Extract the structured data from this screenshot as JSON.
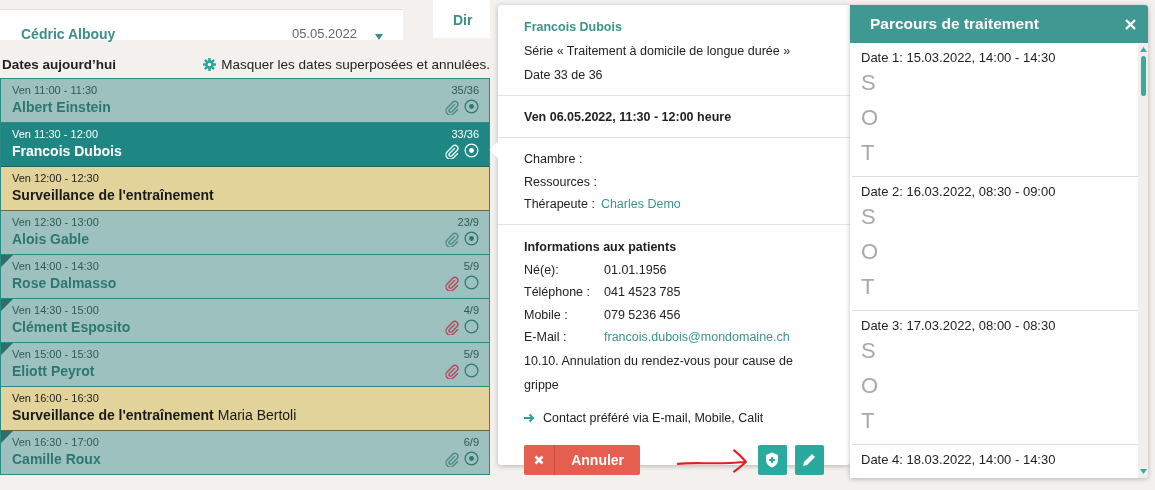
{
  "background_card": {
    "name": "Cédric Albouy",
    "date": "05.05.2022"
  },
  "side_card": {
    "label": "Dir"
  },
  "today": {
    "title": "Dates aujourd’hui",
    "toggle_label": "Masquer les dates superposées et annulées.",
    "appointments": [
      {
        "kind": "patient",
        "time": "Ven 11:00 - 11:30",
        "title": "Albert Einstein",
        "count": "35/36",
        "selected": false,
        "flagged": false,
        "completed": true,
        "attachment_warning": false
      },
      {
        "kind": "patient",
        "time": "Ven 11:30 - 12:00",
        "title": "Francois Dubois",
        "count": "33/36",
        "selected": true,
        "flagged": false,
        "completed": true,
        "attachment_warning": false
      },
      {
        "kind": "training",
        "time": "Ven 12:00 - 12:30",
        "title": "Surveillance de l'entraînement",
        "selected": false
      },
      {
        "kind": "patient",
        "time": "Ven 12:30 - 13:00",
        "title": "Alois Gable",
        "count": "23/9",
        "selected": false,
        "flagged": false,
        "completed": true,
        "attachment_warning": false
      },
      {
        "kind": "patient",
        "time": "Ven 14:00 - 14:30",
        "title": "Rose Dalmasso",
        "count": "5/9",
        "selected": false,
        "flagged": true,
        "completed": false,
        "attachment_warning": true
      },
      {
        "kind": "patient",
        "time": "Ven 14:30 - 15:00",
        "title": "Clément Esposito",
        "count": "4/9",
        "selected": false,
        "flagged": true,
        "completed": false,
        "attachment_warning": true
      },
      {
        "kind": "patient",
        "time": "Ven 15:00 - 15:30",
        "title": "Eliott Peyrot",
        "count": "5/9",
        "selected": false,
        "flagged": true,
        "completed": false,
        "attachment_warning": true
      },
      {
        "kind": "training",
        "time": "Ven 16:00 - 16:30",
        "title": "Surveillance de l'entraînement",
        "extra": "Maria Bertoli",
        "selected": false
      },
      {
        "kind": "patient",
        "time": "Ven 16:30 - 17:00",
        "title": "Camille Roux",
        "count": "6/9",
        "selected": false,
        "flagged": true,
        "completed": true,
        "attachment_warning": false
      }
    ]
  },
  "popup": {
    "patient": "Francois Dubois",
    "series": "Série « Traitement à domicile de longue durée »",
    "date_index": "Date 33 de 36",
    "datetime": "Ven 06.05.2022, 11:30 - 12:00 heure",
    "details": [
      {
        "label": "Chambre :"
      },
      {
        "label": "Ressources :"
      },
      {
        "label": "Thérapeute :",
        "value": "Charles Demo",
        "link": true
      }
    ],
    "info_title": "Informations aux patients",
    "info": [
      {
        "label": "Né(e):",
        "value": "01.01.1956",
        "link": false
      },
      {
        "label": "Téléphone :",
        "value": "041 4523 785",
        "link": false
      },
      {
        "label": "Mobile :",
        "value": "079 5236 456",
        "link": false
      },
      {
        "label": "E-Mail :",
        "value": "francois.dubois@mondomaine.ch",
        "link": true
      }
    ],
    "note": "10.10. Annulation du rendez-vous pour cause de grippe",
    "contact": "Contact préféré via E-mail, Mobile, Calit",
    "cancel_button": "Annuler"
  },
  "treatment_path": {
    "title": "Parcours de traitement",
    "dates": [
      {
        "label": "Date 1: 15.03.2022, 14:00 - 14:30",
        "letters": [
          "S",
          "O",
          "T"
        ]
      },
      {
        "label": "Date 2: 16.03.2022, 08:30 - 09:00",
        "letters": [
          "S",
          "O",
          "T"
        ]
      },
      {
        "label": "Date 3: 17.03.2022, 08:00 - 08:30",
        "letters": [
          "S",
          "O",
          "T"
        ]
      },
      {
        "label": "Date 4: 18.03.2022, 14:00 - 14:30"
      }
    ]
  }
}
